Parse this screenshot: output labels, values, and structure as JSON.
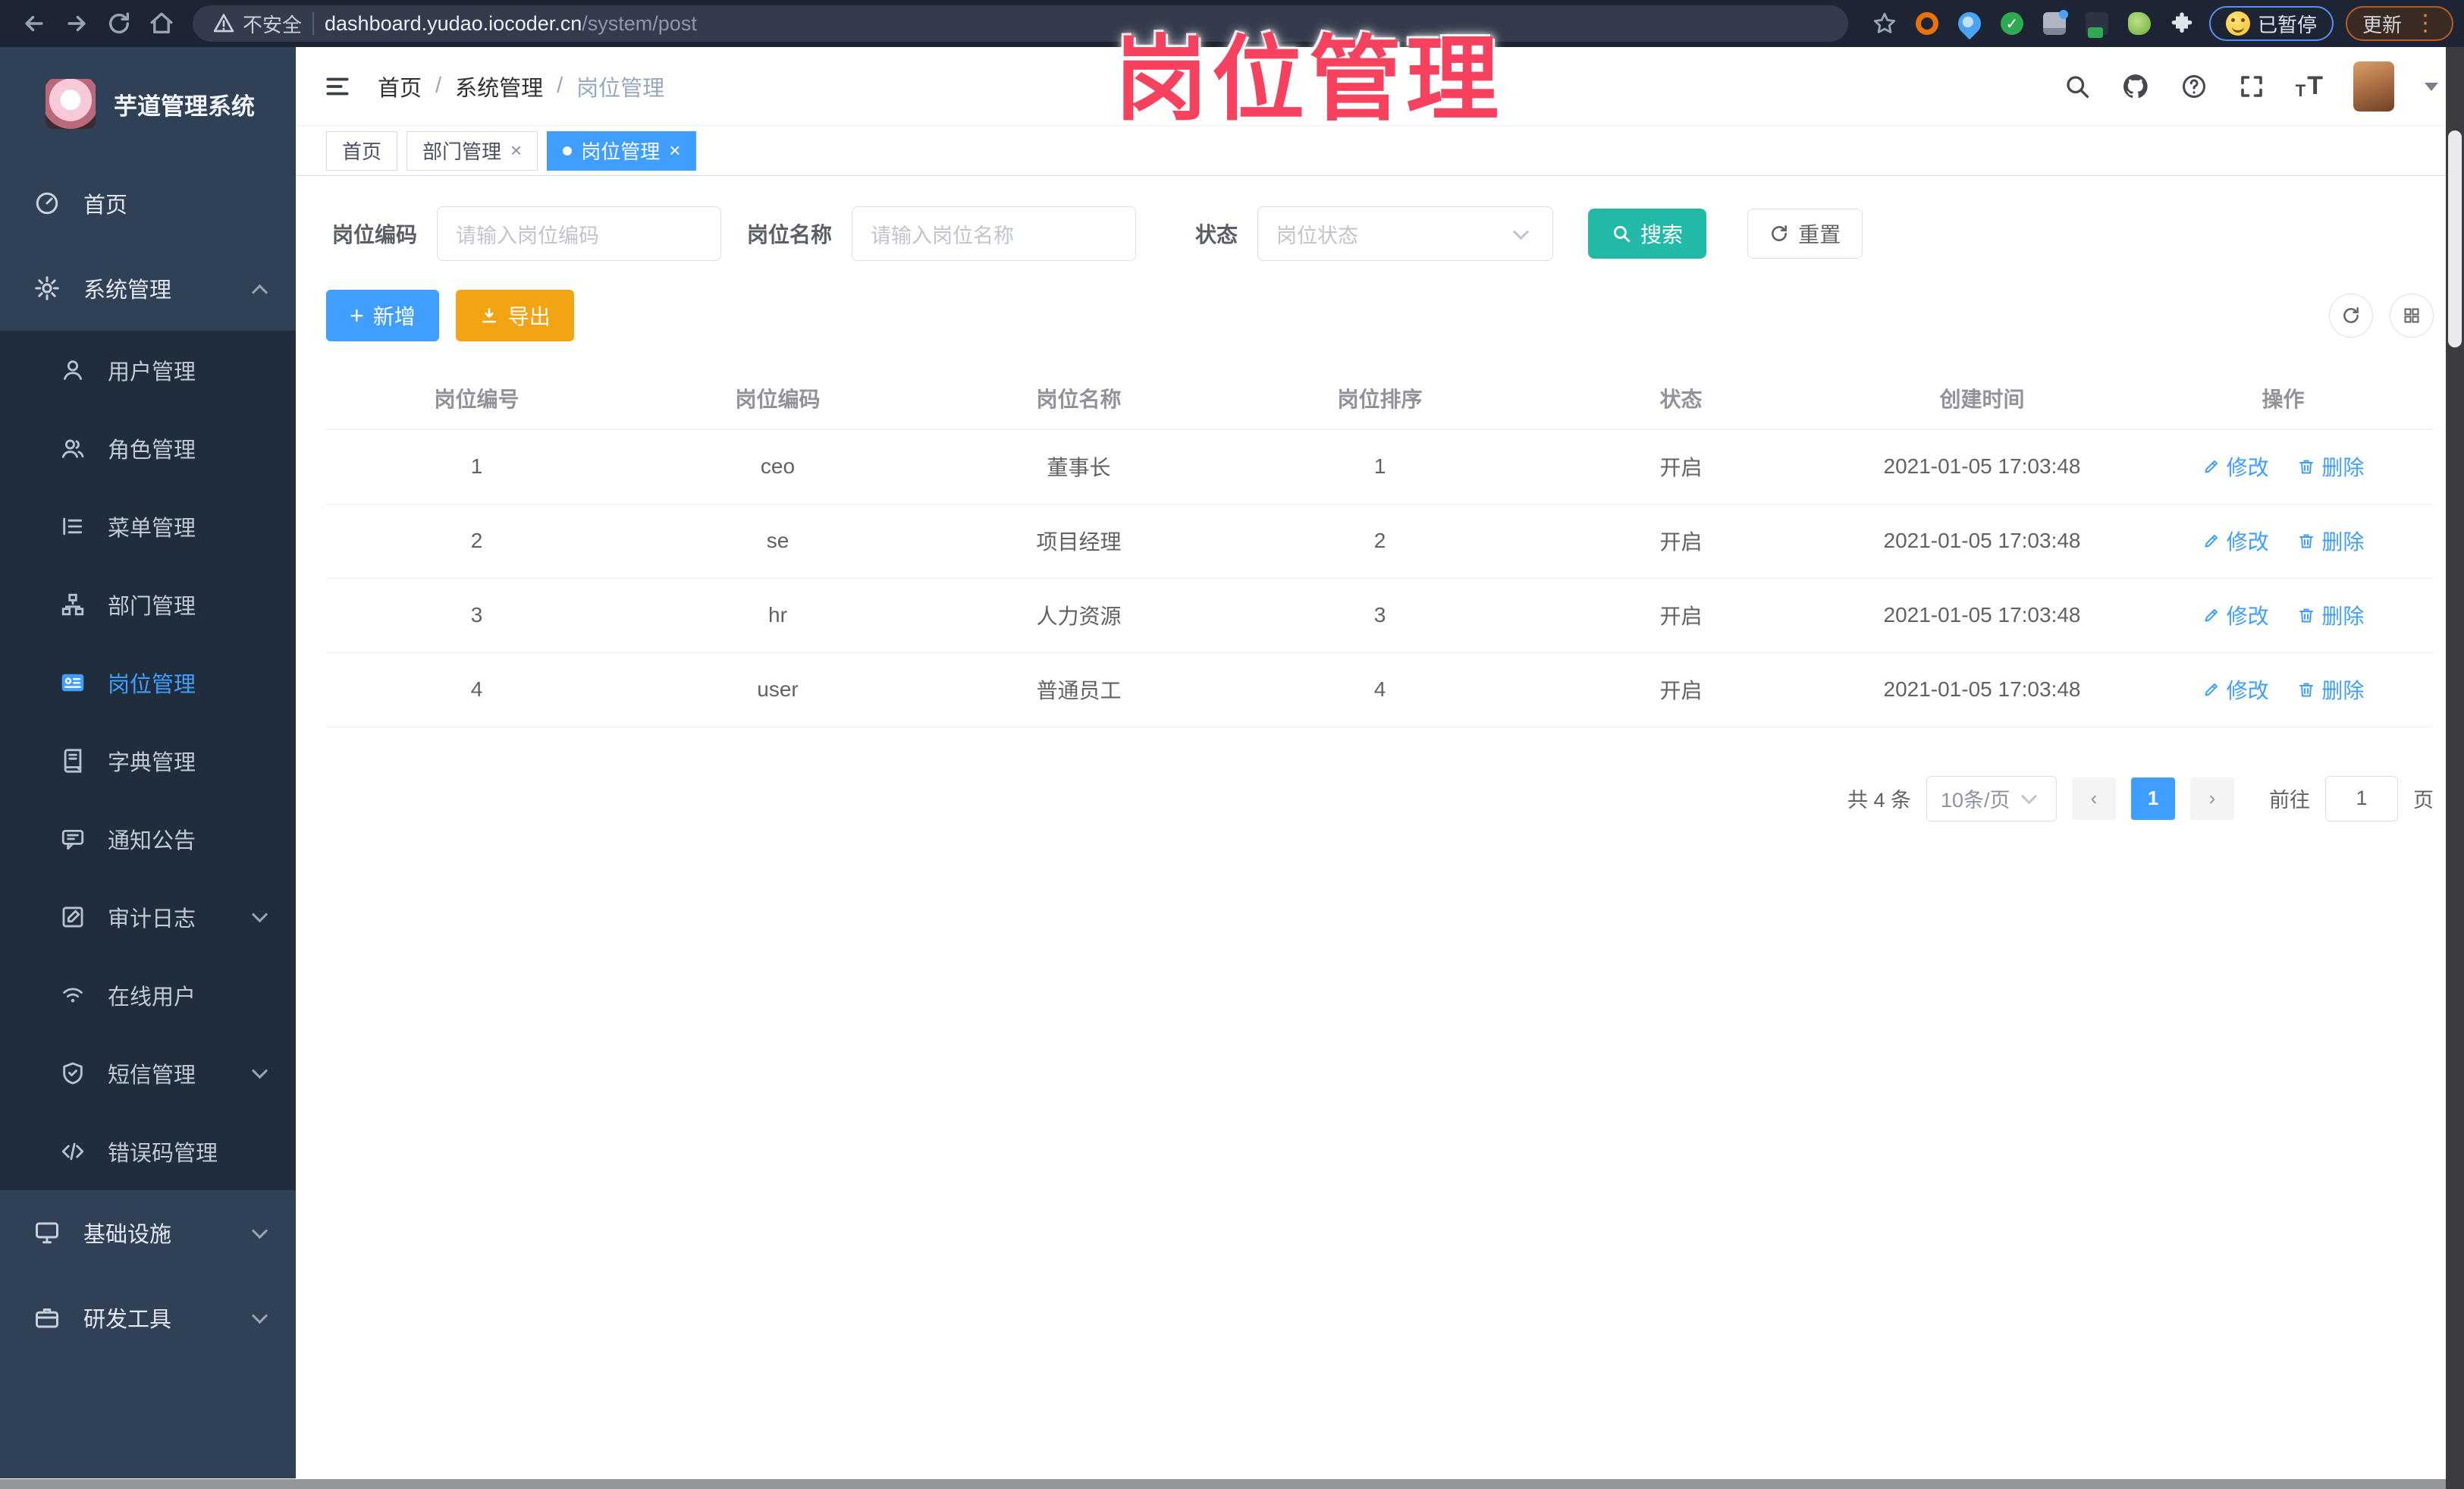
{
  "colors": {
    "accent": "#409eff",
    "search_button": "#22baa6",
    "export_button": "#f2a412",
    "watermark": "#f6415f",
    "sidebar_bg": "#304156",
    "submenu_bg": "#1f2d3d"
  },
  "browser": {
    "security": "不安全",
    "url_domain": "dashboard.yudao.iocoder.cn",
    "url_path": "/system/post",
    "paused_badge": "已暂停",
    "update_button": "更新"
  },
  "watermark": "岗位管理",
  "sidebar": {
    "app_title": "芋道管理系统",
    "items": [
      {
        "label": "首页",
        "icon": "dashboard-icon"
      },
      {
        "label": "系统管理",
        "icon": "gear-icon",
        "expanded": true
      },
      {
        "label": "用户管理",
        "icon": "user-icon"
      },
      {
        "label": "角色管理",
        "icon": "users-icon"
      },
      {
        "label": "菜单管理",
        "icon": "menu-list-icon"
      },
      {
        "label": "部门管理",
        "icon": "org-tree-icon"
      },
      {
        "label": "岗位管理",
        "icon": "postcard-icon",
        "active": true
      },
      {
        "label": "字典管理",
        "icon": "dictionary-icon"
      },
      {
        "label": "通知公告",
        "icon": "announcement-icon"
      },
      {
        "label": "审计日志",
        "icon": "audit-log-icon",
        "collapsible": true
      },
      {
        "label": "在线用户",
        "icon": "online-users-icon"
      },
      {
        "label": "短信管理",
        "icon": "sms-shield-icon",
        "collapsible": true
      },
      {
        "label": "错误码管理",
        "icon": "code-icon"
      },
      {
        "label": "基础设施",
        "icon": "infrastructure-icon",
        "collapsible": true
      },
      {
        "label": "研发工具",
        "icon": "devtools-icon",
        "collapsible": true
      }
    ]
  },
  "header": {
    "breadcrumb": [
      "首页",
      "系统管理",
      "岗位管理"
    ]
  },
  "tabs": [
    {
      "label": "首页"
    },
    {
      "label": "部门管理",
      "closable": true
    },
    {
      "label": "岗位管理",
      "closable": true,
      "active": true
    }
  ],
  "filters": {
    "code_label": "岗位编码",
    "code_placeholder": "请输入岗位编码",
    "name_label": "岗位名称",
    "name_placeholder": "请输入岗位名称",
    "status_label": "状态",
    "status_placeholder": "岗位状态",
    "search_label": "搜索",
    "reset_label": "重置"
  },
  "toolbar": {
    "add_label": "新增",
    "export_label": "导出"
  },
  "table": {
    "columns": [
      "岗位编号",
      "岗位编码",
      "岗位名称",
      "岗位排序",
      "状态",
      "创建时间",
      "操作"
    ],
    "rows": [
      {
        "id": "1",
        "code": "ceo",
        "name": "董事长",
        "sort": "1",
        "status": "开启",
        "created": "2021-01-05 17:03:48"
      },
      {
        "id": "2",
        "code": "se",
        "name": "项目经理",
        "sort": "2",
        "status": "开启",
        "created": "2021-01-05 17:03:48"
      },
      {
        "id": "3",
        "code": "hr",
        "name": "人力资源",
        "sort": "3",
        "status": "开启",
        "created": "2021-01-05 17:03:48"
      },
      {
        "id": "4",
        "code": "user",
        "name": "普通员工",
        "sort": "4",
        "status": "开启",
        "created": "2021-01-05 17:03:48"
      }
    ],
    "edit_label": "修改",
    "delete_label": "删除"
  },
  "pagination": {
    "total": "共 4 条",
    "page_size": "10条/页",
    "prev": "‹",
    "next": "›",
    "current_page": "1",
    "goto_label": "前往",
    "goto_value": "1",
    "page_unit": "页"
  }
}
